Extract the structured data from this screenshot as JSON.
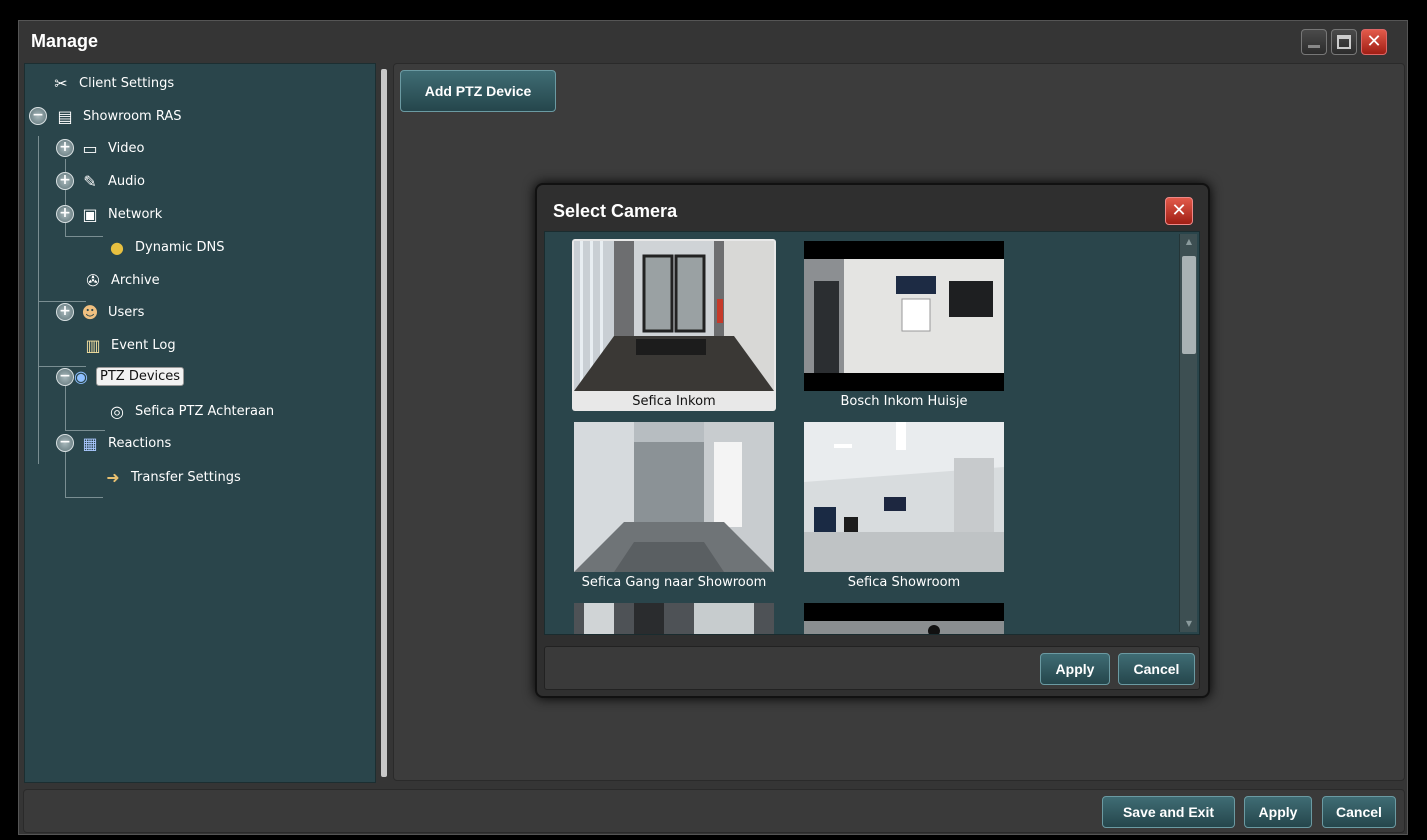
{
  "window": {
    "title": "Manage",
    "close_glyph": "✕"
  },
  "tree": {
    "items": [
      {
        "label": "Client Settings",
        "icon": "tools-icon"
      },
      {
        "label": "Showroom RAS",
        "icon": "server-icon",
        "expander": "−"
      },
      {
        "label": "Video",
        "icon": "monitor-icon",
        "expander": "+"
      },
      {
        "label": "Audio",
        "icon": "microphone-icon",
        "expander": "+"
      },
      {
        "label": "Network",
        "icon": "network-icon",
        "expander": "+"
      },
      {
        "label": "Dynamic DNS",
        "icon": "globe-icon"
      },
      {
        "label": "Archive",
        "icon": "film-reel-icon"
      },
      {
        "label": "Users",
        "icon": "user-icon",
        "expander": "+"
      },
      {
        "label": "Event Log",
        "icon": "document-icon"
      },
      {
        "label": "PTZ Devices",
        "icon": "ptz-camera-icon",
        "expander": "−",
        "selected": true
      },
      {
        "label": "Sefica PTZ Achteraan",
        "icon": "webcam-icon"
      },
      {
        "label": "Reactions",
        "icon": "calendar-clock-icon",
        "expander": "−"
      },
      {
        "label": "Transfer Settings",
        "icon": "transfer-icon"
      }
    ]
  },
  "content": {
    "add_ptz_label": "Add PTZ Device"
  },
  "dialog": {
    "title": "Select Camera",
    "close_glyph": "✕",
    "cameras": [
      {
        "name": "Sefica Inkom",
        "selected": true
      },
      {
        "name": "Bosch Inkom Huisje"
      },
      {
        "name": "Sefica Gang naar Showroom"
      },
      {
        "name": "Sefica Showroom"
      },
      {
        "name": ""
      },
      {
        "name": ""
      }
    ],
    "apply_label": "Apply",
    "cancel_label": "Cancel"
  },
  "footer": {
    "save_exit_label": "Save and Exit",
    "apply_label": "Apply",
    "cancel_label": "Cancel"
  }
}
